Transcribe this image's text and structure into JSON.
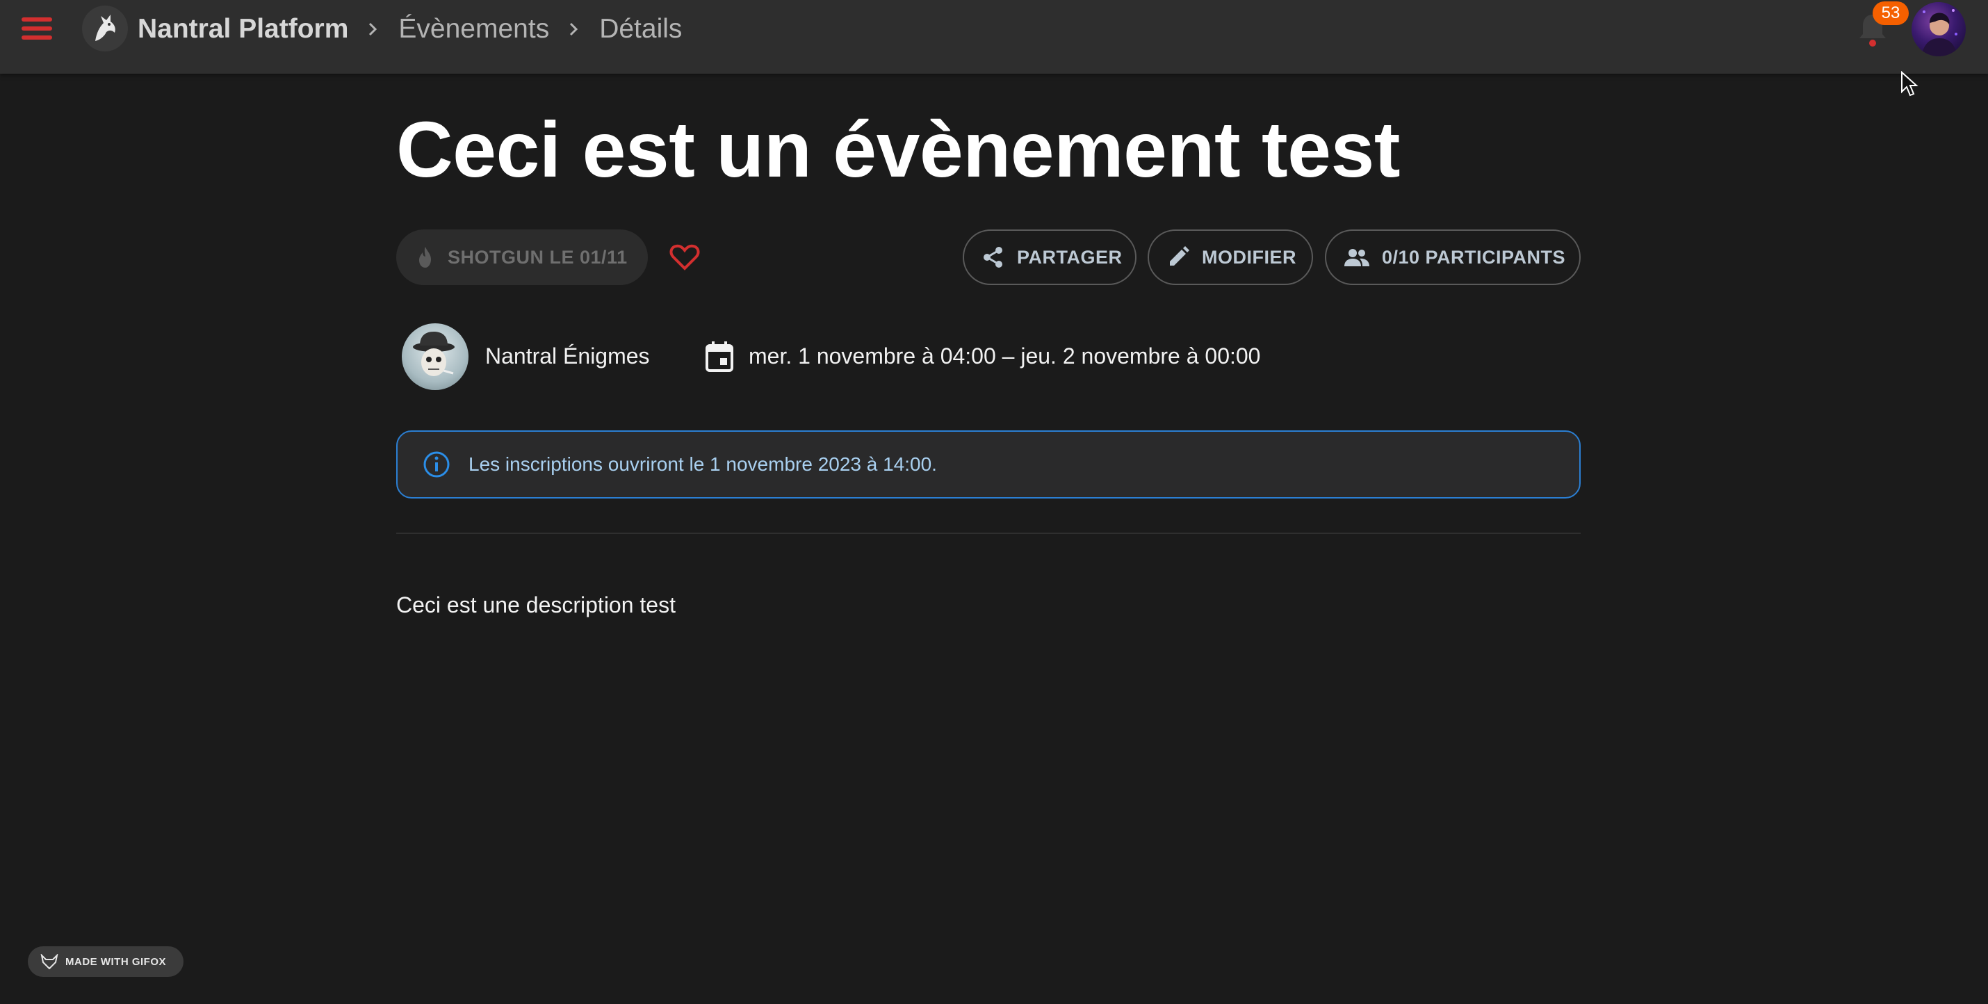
{
  "header": {
    "app_name": "Nantral Platform",
    "breadcrumbs": [
      "Évènements",
      "Détails"
    ],
    "notifications_count": "53",
    "icons": {
      "menu": "hamburger-menu-icon",
      "logo": "nantral-logo-icon",
      "bell": "bell-icon",
      "avatar": "user-avatar"
    }
  },
  "event": {
    "title": "Ceci est un évènement test",
    "shotgun_label": "SHOTGUN LE 01/11",
    "share_label": "PARTAGER",
    "edit_label": "MODIFIER",
    "participants_label": "0/10 PARTICIPANTS",
    "organizer": "Nantral Énigmes",
    "dates": "mer. 1 novembre à 04:00 – jeu. 2 novembre à 00:00",
    "alert": "Les inscriptions ouvriront le 1 novembre 2023 à 14:00.",
    "description": "Ceci est une description test"
  },
  "footer": {
    "gifox_label": "MADE WITH GIFOX"
  },
  "colors": {
    "background": "#1b1b1b",
    "topbar": "#2e2e2e",
    "accent_red": "#d32f2f",
    "badge_orange": "#f56000",
    "info_blue": "#2b7fd3"
  }
}
